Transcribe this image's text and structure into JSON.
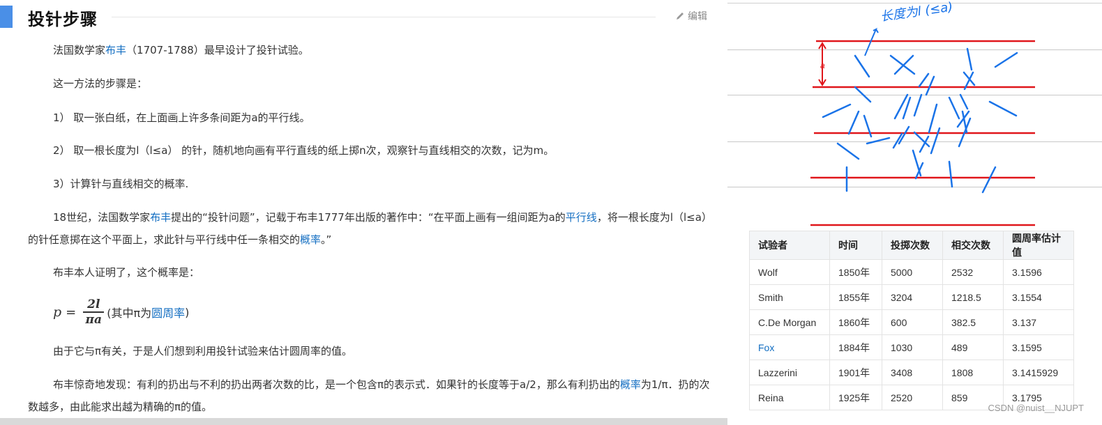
{
  "article": {
    "title": "投针步骤",
    "edit_label": "编辑",
    "p1": {
      "pre": "法国数学家",
      "link": "布丰",
      "post": "（1707-1788）最早设计了投针试验。"
    },
    "p2": "这一方法的步骤是：",
    "p3": "1）  取一张白纸，在上面画上许多条间距为a的平行线。",
    "p4": "2）  取一根长度为l（l≤a） 的针，随机地向画有平行直线的纸上掷n次，观察针与直线相交的次数，记为m。",
    "p5": "3）计算针与直线相交的概率.",
    "p6": {
      "pre": "18世纪，法国数学家",
      "link1": "布丰",
      "mid1": "提出的“投针问题”，记载于布丰1777年出版的著作中：“在平面上画有一组间距为a的",
      "link2": "平行线",
      "mid2": "，将一根长度为l（l≤a）的针任意掷在这个平面上，求此针与平行线中任一条相交的",
      "link3": "概率",
      "post": "。”"
    },
    "p7": "布丰本人证明了，这个概率是：",
    "formula": {
      "lhs": "p",
      "eq": "=",
      "numerator": "2l",
      "denominator": "πa",
      "note_pre": "(其中π为",
      "note_link": "圆周率",
      "note_post": ")"
    },
    "p8": "由于它与π有关，于是人们想到利用投针试验来估计圆周率的值。",
    "p9": {
      "pre": "布丰惊奇地发现：有利的扔出与不利的扔出两者次数的比，是一个包含π的表示式．如果针的长度等于a/2，那么有利扔出的",
      "link": "概率",
      "post": "为1/π．扔的次数越多，由此能求出越为精确的π的值。"
    }
  },
  "sketch": {
    "annotation": "长度为l (≤a)",
    "spacing_label": "a",
    "line_color": "#e0161b",
    "needle_color": "#1a73e8"
  },
  "table": {
    "headers": [
      "试验者",
      "时间",
      "投掷次数",
      "相交次数",
      "圆周率估计值"
    ],
    "rows": [
      {
        "name": "Wolf",
        "year": "1850年",
        "throws": "5000",
        "hits": "2532",
        "pi": "3.1596",
        "link": false
      },
      {
        "name": "Smith",
        "year": "1855年",
        "throws": "3204",
        "hits": "1218.5",
        "pi": "3.1554",
        "link": false
      },
      {
        "name": "C.De Morgan",
        "year": "1860年",
        "throws": "600",
        "hits": "382.5",
        "pi": "3.137",
        "link": false
      },
      {
        "name": "Fox",
        "year": "1884年",
        "throws": "1030",
        "hits": "489",
        "pi": "3.1595",
        "link": true
      },
      {
        "name": "Lazzerini",
        "year": "1901年",
        "throws": "3408",
        "hits": "1808",
        "pi": "3.1415929",
        "link": false
      },
      {
        "name": "Reina",
        "year": "1925年",
        "throws": "2520",
        "hits": "859",
        "pi": "3.1795",
        "link": false
      }
    ]
  },
  "watermark": "CSDN @nuist__NJUPT",
  "colors": {
    "accent": "#4a8fe7",
    "link": "#136ec2"
  }
}
